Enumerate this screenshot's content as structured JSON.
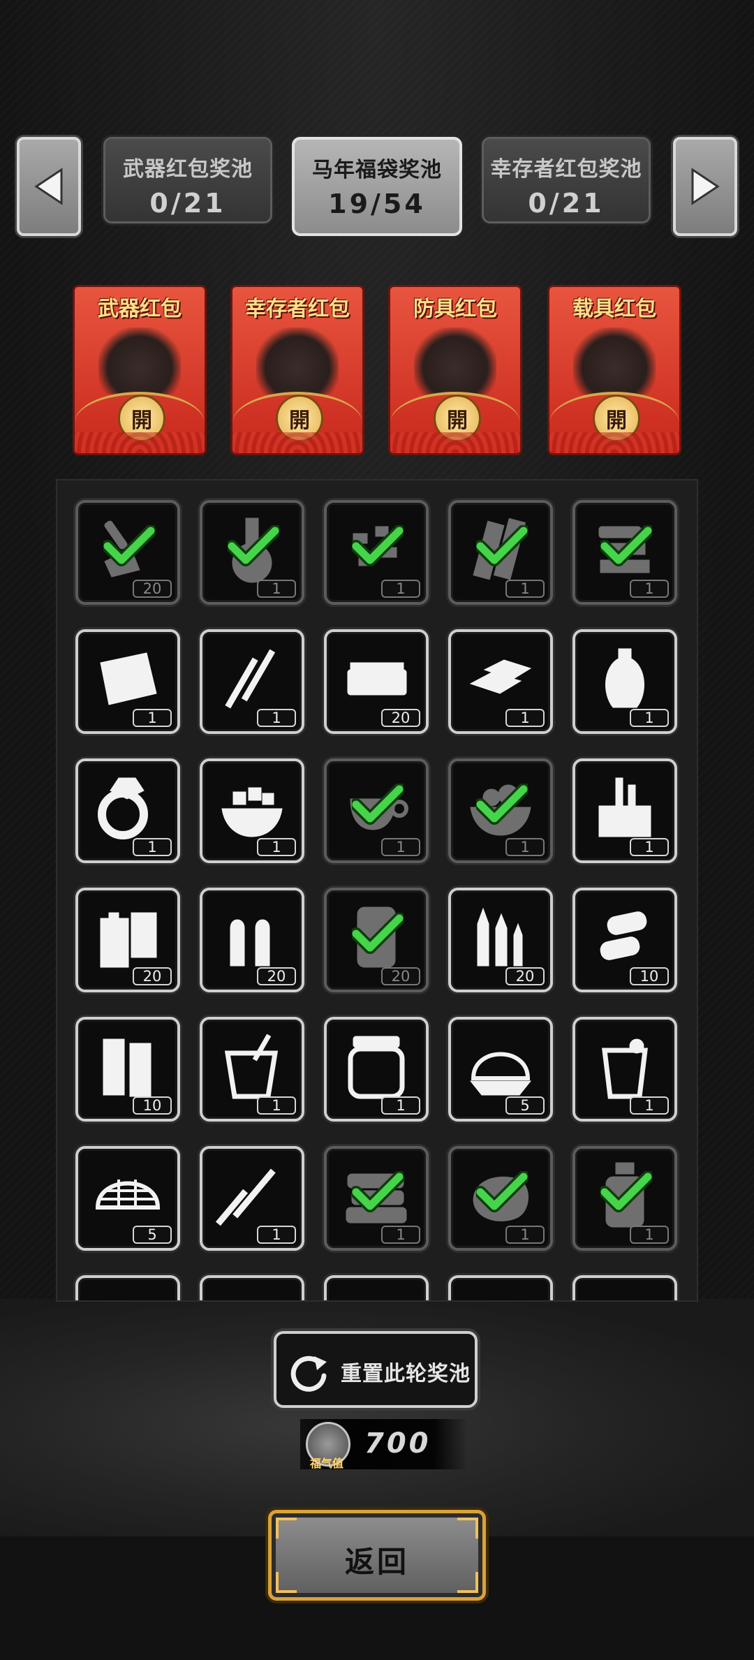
{
  "pools": [
    {
      "name": "武器红包奖池",
      "count": "0/21",
      "active": false
    },
    {
      "name": "马年福袋奖池",
      "count": "19/54",
      "active": true
    },
    {
      "name": "幸存者红包奖池",
      "count": "0/21",
      "active": false
    }
  ],
  "envelopes": [
    {
      "title": "武器红包",
      "seal": "開"
    },
    {
      "title": "幸存者红包",
      "seal": "開"
    },
    {
      "title": "防具红包",
      "seal": "開"
    },
    {
      "title": "载具红包",
      "seal": "開"
    }
  ],
  "items": [
    {
      "icon": "shovel-icon",
      "qty": "20",
      "collected": true
    },
    {
      "icon": "flask-icon",
      "qty": "1",
      "collected": true
    },
    {
      "icon": "scrap-pieces-icon",
      "qty": "1",
      "collected": true
    },
    {
      "icon": "wood-planks-icon",
      "qty": "1",
      "collected": true
    },
    {
      "icon": "scrap-pile-icon",
      "qty": "1",
      "collected": true
    },
    {
      "icon": "cloth-icon",
      "qty": "1",
      "collected": false
    },
    {
      "icon": "incense-sticks-icon",
      "qty": "1",
      "collected": false
    },
    {
      "icon": "cash-bundle-icon",
      "qty": "20",
      "collected": false
    },
    {
      "icon": "gold-bars-icon",
      "qty": "1",
      "collected": false
    },
    {
      "icon": "vase-icon",
      "qty": "1",
      "collected": false
    },
    {
      "icon": "ring-icon",
      "qty": "1",
      "collected": false
    },
    {
      "icon": "sugar-bowl-icon",
      "qty": "1",
      "collected": false
    },
    {
      "icon": "coffee-cup-icon",
      "qty": "1",
      "collected": true
    },
    {
      "icon": "food-bowl-icon",
      "qty": "1",
      "collected": true
    },
    {
      "icon": "toolbox-icon",
      "qty": "1",
      "collected": false
    },
    {
      "icon": "batteries-icon",
      "qty": "20",
      "collected": false
    },
    {
      "icon": "pistol-ammo-icon",
      "qty": "20",
      "collected": false
    },
    {
      "icon": "oil-barrel-icon",
      "qty": "20",
      "collected": true
    },
    {
      "icon": "rifle-ammo-icon",
      "qty": "20",
      "collected": false
    },
    {
      "icon": "shotgun-shells-icon",
      "qty": "10",
      "collected": false
    },
    {
      "icon": "shells-icon",
      "qty": "10",
      "collected": false
    },
    {
      "icon": "drink-cup-icon",
      "qty": "1",
      "collected": false
    },
    {
      "icon": "pickle-jar-icon",
      "qty": "1",
      "collected": false
    },
    {
      "icon": "dome-net-icon",
      "qty": "5",
      "collected": false
    },
    {
      "icon": "lemonade-icon",
      "qty": "1",
      "collected": false
    },
    {
      "icon": "net-icon",
      "qty": "5",
      "collected": false
    },
    {
      "icon": "claw-icon",
      "qty": "1",
      "collected": false
    },
    {
      "icon": "fabric-pile-icon",
      "qty": "1",
      "collected": true
    },
    {
      "icon": "rock-icon",
      "qty": "1",
      "collected": true
    },
    {
      "icon": "bottle-icon",
      "qty": "1",
      "collected": true
    }
  ],
  "reset": {
    "label": "重置此轮奖池"
  },
  "luck": {
    "label": "福气值",
    "value": "700"
  },
  "back": {
    "label": "返回"
  }
}
